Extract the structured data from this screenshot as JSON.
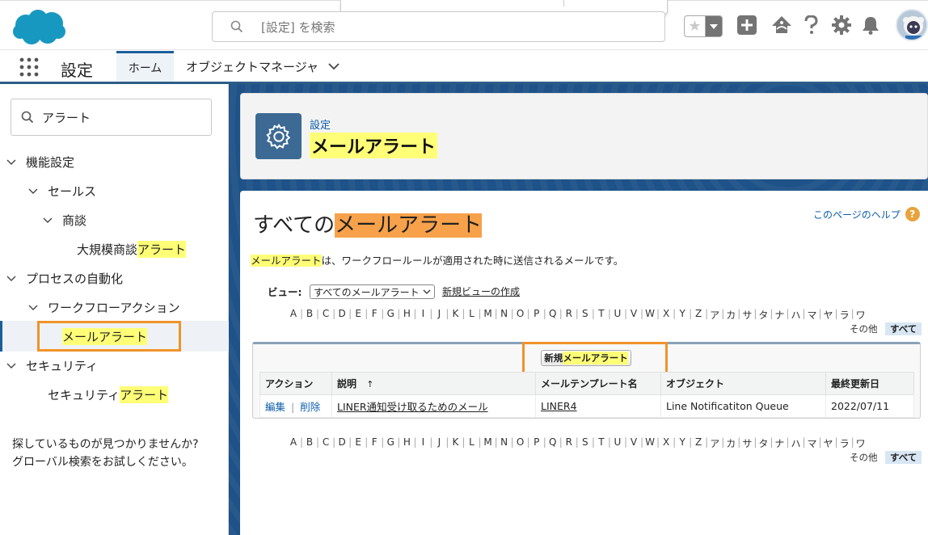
{
  "header": {
    "search_placeholder": "[設定] を検索"
  },
  "app_nav": {
    "app_name": "設定",
    "tab_home": "ホーム",
    "tab_object_manager": "オブジェクトマネージャ"
  },
  "sidebar": {
    "quickfind_value": "アラート",
    "items": [
      {
        "label": "機能設定"
      },
      {
        "label": "セールス"
      },
      {
        "label": "商談"
      },
      {
        "label_plain": "大規模商談",
        "label_hl": "アラート"
      },
      {
        "label": "プロセスの自動化"
      },
      {
        "label": "ワークフローアクション"
      },
      {
        "label": "メールアラート"
      },
      {
        "label": "セキュリティ"
      },
      {
        "label_plain": "セキュリティ",
        "label_hl": "アラート"
      }
    ],
    "not_found_line1": "探しているものが見つかりませんか?",
    "not_found_line2": "グローバル検索をお試しください。"
  },
  "page_header": {
    "breadcrumb": "設定",
    "title": "メールアラート"
  },
  "content": {
    "title_prefix": "すべての",
    "title_hl": "メールアラート",
    "help_link": "このページのヘルプ",
    "desc_hl": "メールアラート",
    "desc_rest": "は、ワークフロールールが適用された時に送信されるメールです。",
    "view_label": "ビュー:",
    "view_selected": "すべてのメールアラート",
    "new_view_link": "新規ビューの作成",
    "alpha": [
      "A",
      "B",
      "C",
      "D",
      "E",
      "F",
      "G",
      "H",
      "I",
      "J",
      "K",
      "L",
      "M",
      "N",
      "O",
      "P",
      "Q",
      "R",
      "S",
      "T",
      "U",
      "V",
      "W",
      "X",
      "Y",
      "Z",
      "ア",
      "カ",
      "サ",
      "タ",
      "ナ",
      "ハ",
      "マ",
      "ヤ",
      "ラ",
      "ワ"
    ],
    "alpha_other": "その他",
    "alpha_all": "すべて",
    "new_button_prefix": "新規",
    "new_button_hl": "メールアラート",
    "table": {
      "headers": [
        "アクション",
        "説明",
        "メールテンプレート名",
        "オブジェクト",
        "最終更新日"
      ],
      "sort_indicator": "↑",
      "rows": [
        {
          "edit": "編集",
          "sep": "|",
          "delete": "削除",
          "description": "LINER通知受け取るためのメール",
          "template": "LINER4",
          "object": "Line Notificatiton Queue",
          "modified": "2022/07/11"
        }
      ]
    }
  }
}
